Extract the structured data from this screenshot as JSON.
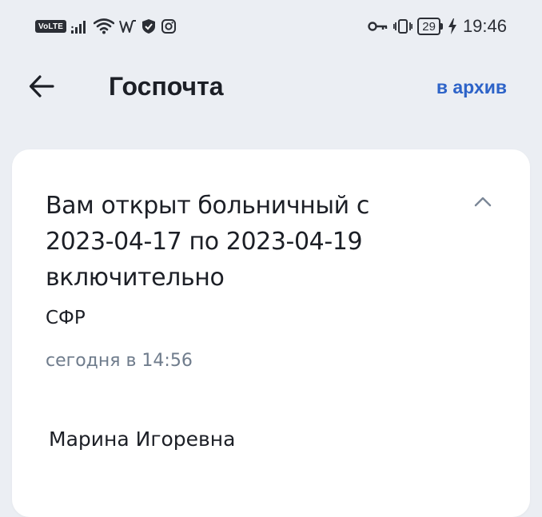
{
  "status_bar": {
    "network_badge": "VoLTE",
    "battery_level": "29",
    "time": "19:46",
    "icons": [
      "volte-icon",
      "signal-icon",
      "wifi-icon",
      "vpn-icon",
      "shield-icon",
      "instagram-icon",
      "key-icon",
      "vibrate-icon",
      "battery-icon",
      "charging-icon"
    ]
  },
  "header": {
    "title": "Госпочта",
    "archive_label": "в архив"
  },
  "message": {
    "subject": "Вам открыт больничный с 2023-04-17 по 2023-04-19 включительно",
    "sender": "СФР",
    "time": "сегодня в 14:56",
    "body_preview": "Марина Игоревна"
  },
  "colors": {
    "background": "#ebeef3",
    "card": "#ffffff",
    "accent": "#2d63c8",
    "muted_text": "#6f7c8c"
  }
}
